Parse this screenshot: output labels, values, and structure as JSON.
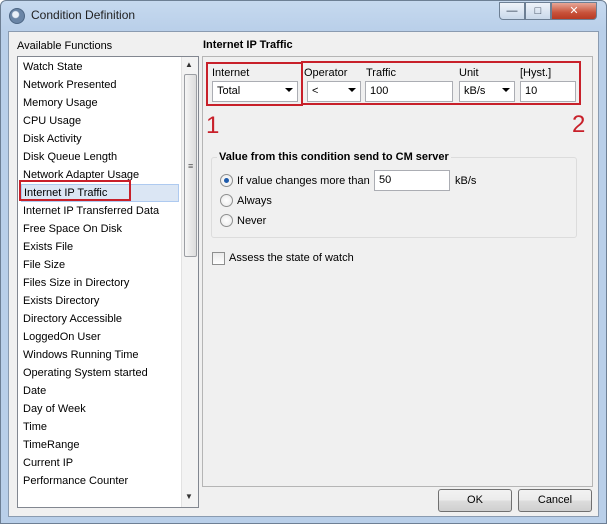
{
  "window": {
    "title": "Condition Definition",
    "min_glyph": "—",
    "max_glyph": "□",
    "close_glyph": "✕"
  },
  "functions": {
    "label": "Available Functions",
    "items": [
      "Watch State",
      "Network Presented",
      "Memory Usage",
      "CPU Usage",
      "Disk Activity",
      "Disk Queue Length",
      "Network Adapter Usage",
      "Internet IP Traffic",
      "Internet IP Transferred Data",
      "Free Space On Disk",
      "Exists File",
      "File Size",
      "Files Size in Directory",
      "Exists Directory",
      "Directory Accessible",
      "LoggedOn User",
      "Windows Running Time",
      "Operating System started",
      "Date",
      "Day of Week",
      "Time",
      "TimeRange",
      "Current IP",
      "Performance Counter"
    ],
    "selected_index": 7
  },
  "panel": {
    "title": "Internet IP Traffic",
    "internet_label": "Internet",
    "internet_value": "Total",
    "operator_label": "Operator",
    "operator_value": "<",
    "traffic_label": "Traffic",
    "traffic_value": "100",
    "unit_label": "Unit",
    "unit_value": "kB/s",
    "hyst_label": "[Hyst.]",
    "hyst_value": "10",
    "group_title": "Value from this condition send to CM server",
    "radio_change": "If value changes more than",
    "change_value": "50",
    "change_unit": "kB/s",
    "radio_always": "Always",
    "radio_never": "Never",
    "assess_label": "Assess the state of watch",
    "annotation_1": "1",
    "annotation_2": "2"
  },
  "buttons": {
    "ok": "OK",
    "cancel": "Cancel"
  }
}
